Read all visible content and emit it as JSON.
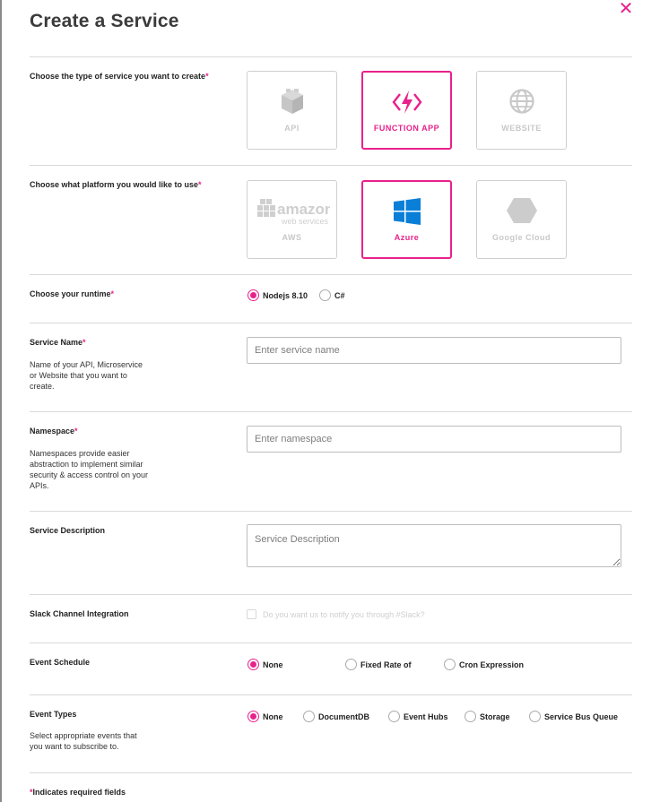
{
  "title": "Create a Service",
  "close_icon": "close-icon",
  "required_marker": "*",
  "service_type": {
    "label": "Choose the type of service you want to create",
    "options": [
      {
        "name": "API",
        "icon": "cube-icon",
        "selected": false
      },
      {
        "name": "FUNCTION APP",
        "icon": "function-bolt-icon",
        "selected": true
      },
      {
        "name": "WEBSITE",
        "icon": "globe-icon",
        "selected": false
      }
    ]
  },
  "platform": {
    "label": "Choose what platform you would like to use",
    "options": [
      {
        "name": "AWS",
        "logo_text": "amazon",
        "logo_subtext": "web services",
        "icon": "aws-logo-icon",
        "selected": false
      },
      {
        "name": "Azure",
        "icon": "windows-logo-icon",
        "selected": true
      },
      {
        "name": "Google Cloud",
        "icon": "hexagon-icon",
        "selected": false
      }
    ]
  },
  "runtime": {
    "label": "Choose your runtime",
    "options": [
      "Nodejs 8.10",
      "C#"
    ],
    "selected": "Nodejs 8.10"
  },
  "service_name": {
    "label": "Service Name",
    "description": "Name of your API, Microservice or Website that you want to create.",
    "placeholder": "Enter service name",
    "value": ""
  },
  "namespace": {
    "label": "Namespace",
    "description": "Namespaces provide easier abstraction to implement similar security & access control on your APIs.",
    "placeholder": "Enter namespace",
    "value": ""
  },
  "service_description": {
    "label": "Service Description",
    "placeholder": "Service Description",
    "value": ""
  },
  "slack": {
    "label": "Slack Channel Integration",
    "checkbox_label": "Do you want us to notify you through #Slack?",
    "checked": false
  },
  "event_schedule": {
    "label": "Event Schedule",
    "options": [
      "None",
      "Fixed Rate of",
      "Cron Expression"
    ],
    "selected": "None"
  },
  "event_types": {
    "label": "Event Types",
    "description": "Select appropriate events that you want to subscribe to.",
    "options": [
      "None",
      "DocumentDB",
      "Event Hubs",
      "Storage",
      "Service Bus Queue"
    ],
    "selected": "None"
  },
  "footer_note": "Indicates required fields",
  "colors": {
    "accent": "#e8218c",
    "azure": "#0a7fd8",
    "muted": "#c8c8c8"
  }
}
